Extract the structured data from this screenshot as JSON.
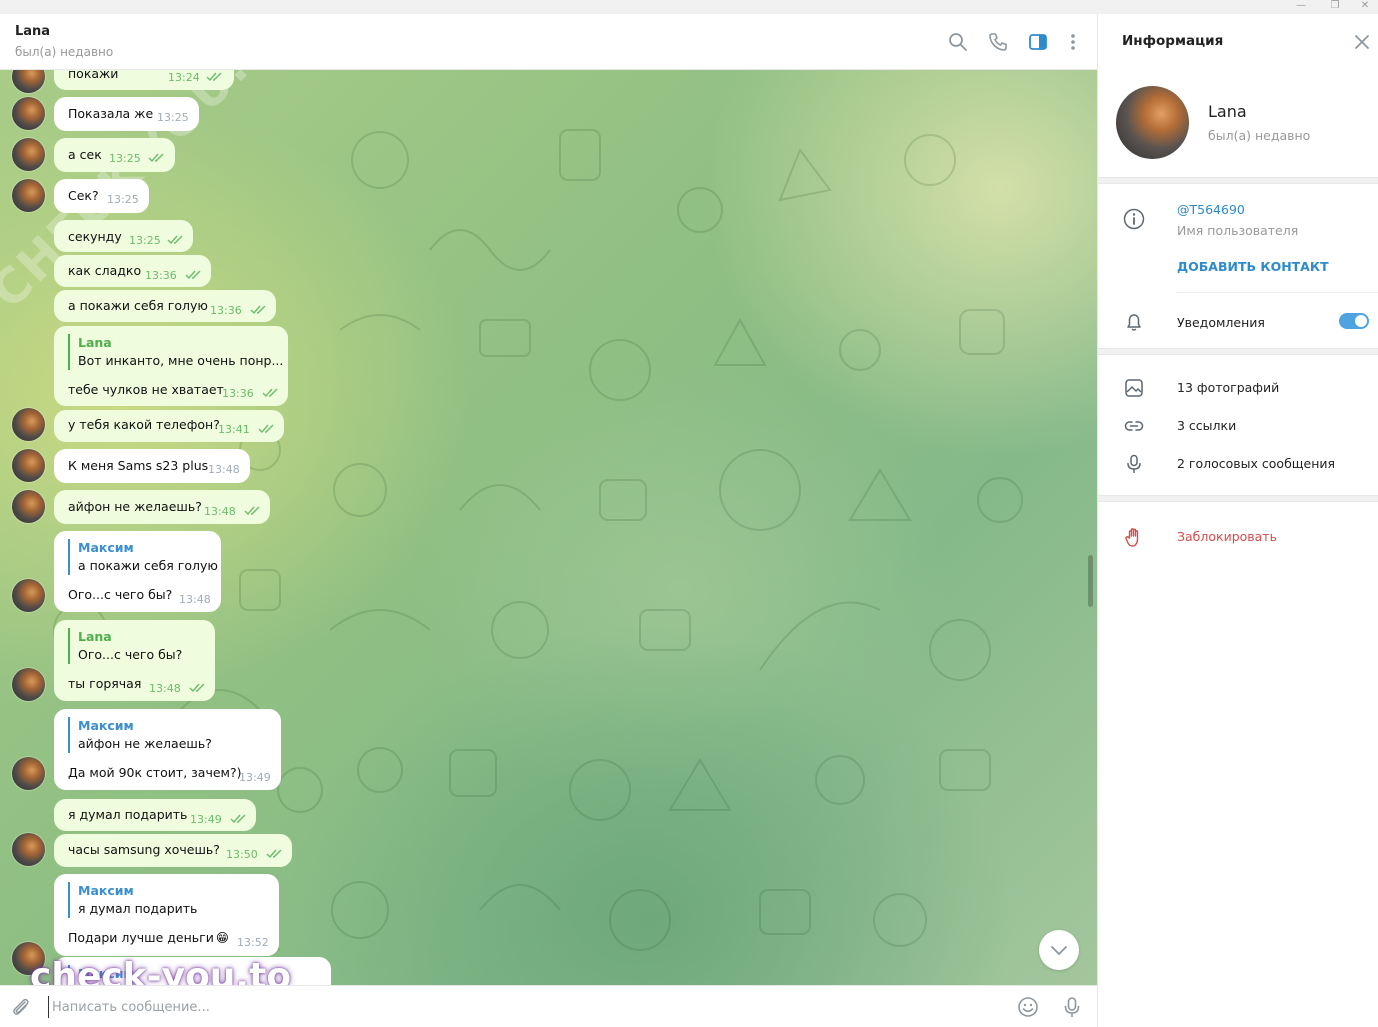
{
  "window": {
    "minimize": "—",
    "maximize": "❐",
    "close": "✕"
  },
  "header": {
    "title": "Lana",
    "status": "был(а) недавно"
  },
  "messages": [
    {
      "text": "покажи",
      "time": "13:24"
    },
    {
      "text": "Показала же",
      "time": "13:25"
    },
    {
      "text": "а сек",
      "time": "13:25"
    },
    {
      "text": "Сек?",
      "time": "13:25"
    },
    {
      "text": "секунду",
      "time": "13:25"
    },
    {
      "text": "как сладко",
      "time": "13:36"
    },
    {
      "text": "а покажи себя голую",
      "time": "13:36"
    },
    {
      "reply_name": "Lana",
      "reply_text": "Вот инканто, мне очень понр...",
      "text": "тебе чулков не хватает",
      "time": "13:36"
    },
    {
      "text": "у тебя какой телефон?",
      "time": "13:41"
    },
    {
      "text": "К меня Sams s23 plus",
      "time": "13:48"
    },
    {
      "text": "айфон не желаешь?",
      "time": "13:48"
    },
    {
      "reply_name": "Максим",
      "reply_text": "а покажи себя голую",
      "text": "Ого...с чего бы?",
      "time": "13:48"
    },
    {
      "reply_name": "Lana",
      "reply_text": "Ого...с чего бы?",
      "text": "ты горячая",
      "time": "13:48"
    },
    {
      "reply_name": "Максим",
      "reply_text": "айфон не желаешь?",
      "text": "Да мой 90к стоит, зачем?)",
      "time": "13:49"
    },
    {
      "text": "я думал подарить",
      "time": "13:49"
    },
    {
      "text": "часы samsung хочешь?",
      "time": "13:50"
    },
    {
      "reply_name": "Максим",
      "reply_text": "я думал подарить",
      "text": "Подари лучше деньги",
      "emoji": "😁",
      "time": "13:52"
    },
    {
      "reply_name": "Максим"
    }
  ],
  "watermark": {
    "bottom": "check-you.to",
    "diagonal": "CHECK-YOU.ME"
  },
  "composer": {
    "placeholder": "Написать сообщение..."
  },
  "info_panel": {
    "title": "Информация",
    "name": "Lana",
    "status": "был(а) недавно",
    "username": "@T564690",
    "username_label": "Имя пользователя",
    "add_contact": "ДОБАВИТЬ КОНТАКТ",
    "notifications": "Уведомления",
    "notifications_on": true,
    "photos": "13 фотографий",
    "links": "3 ссылки",
    "voice": "2 голосовых сообщения",
    "block": "Заблокировать"
  },
  "colors": {
    "accent": "#2e8acb",
    "outgoing_bubble": "#effdde",
    "incoming_bubble": "#ffffff",
    "check_green": "#6dbb6d",
    "danger": "#d14e4e"
  }
}
